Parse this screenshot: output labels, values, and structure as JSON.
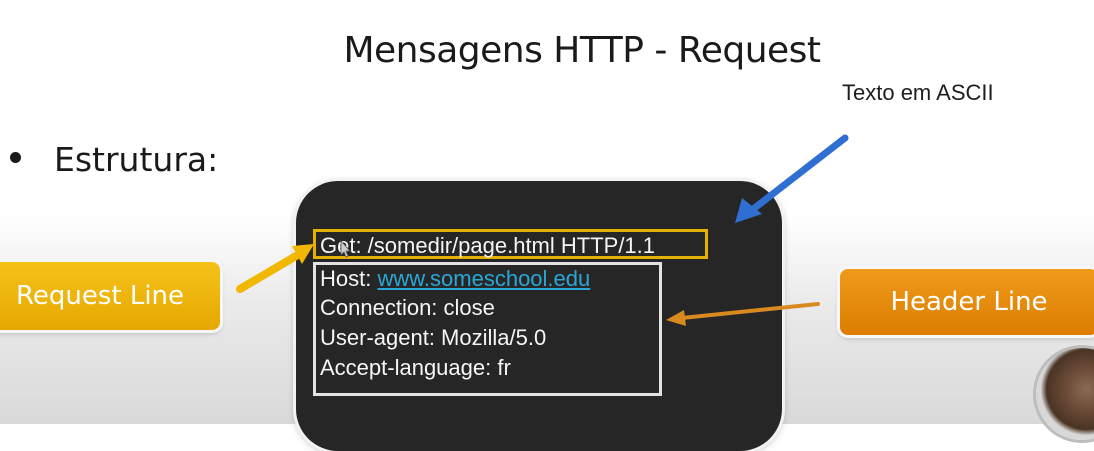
{
  "slide": {
    "title": "Mensagens HTTP - Request",
    "ascii_note": "Texto em ASCII",
    "bullet": "Estrutura:"
  },
  "message": {
    "request_line": "Get: /somedir/page.html HTTP/1.1",
    "host_label": "Host: ",
    "host_link": "www.someschool.edu",
    "connection": "Connection: close",
    "user_agent": "User-agent: Mozilla/5.0",
    "accept_language": "Accept-language: fr"
  },
  "labels": {
    "request_line": "Request Line",
    "header_line": "Header Line"
  },
  "colors": {
    "request_line_accent": "#e6b000",
    "header_line_accent": "#e08300",
    "message_background": "#262626",
    "link": "#2aa7d6",
    "ascii_arrow": "#2e6fd1"
  }
}
